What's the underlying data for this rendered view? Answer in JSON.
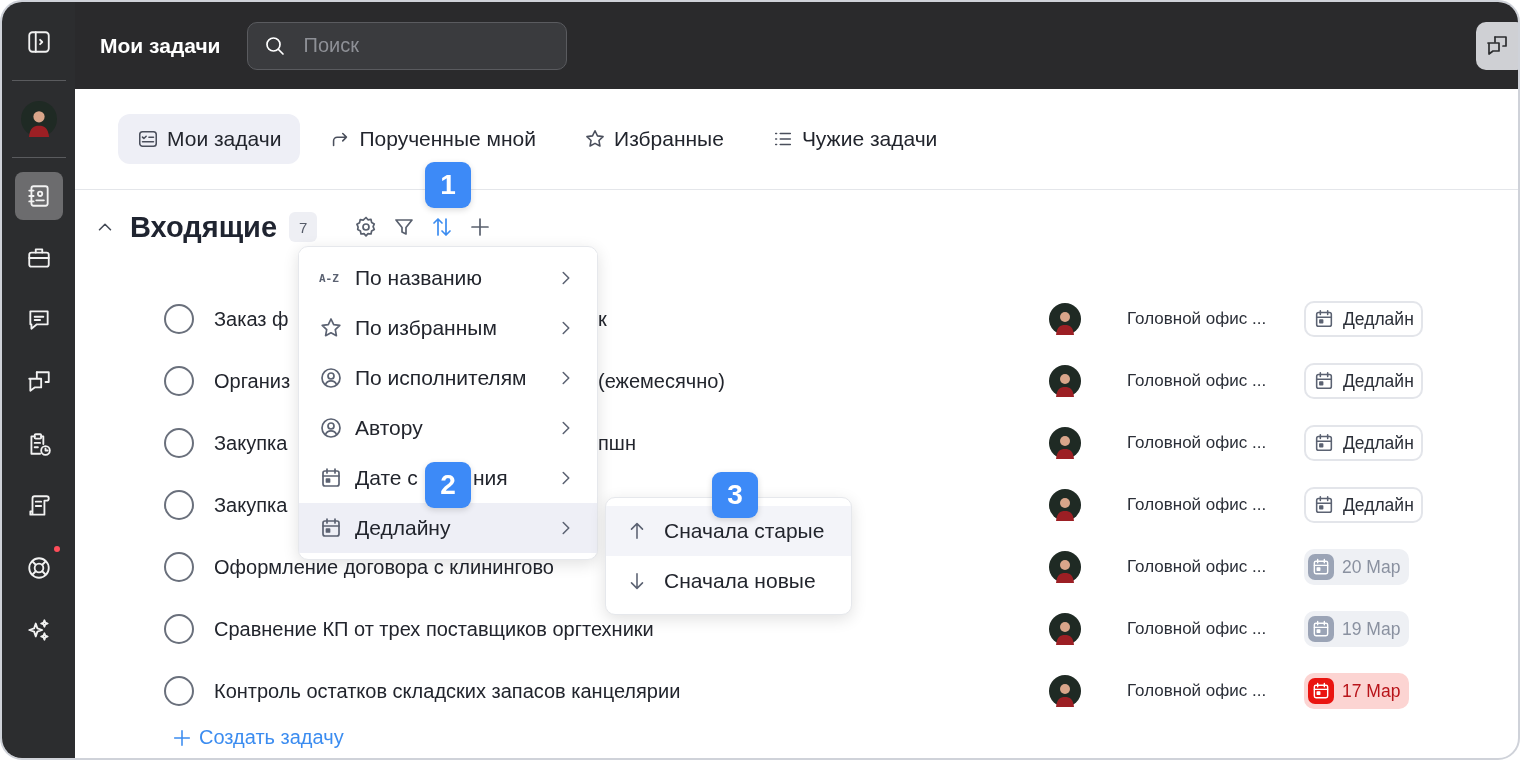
{
  "header": {
    "title": "Мои задачи",
    "search": {
      "placeholder": "Поиск"
    }
  },
  "sidebar": {
    "items": [
      {
        "selected": false,
        "notification": false
      },
      {
        "selected": true,
        "notification": false
      },
      {
        "selected": false,
        "notification": false
      },
      {
        "selected": false,
        "notification": false
      },
      {
        "selected": false,
        "notification": false
      },
      {
        "selected": false,
        "notification": false
      },
      {
        "selected": false,
        "notification": false
      },
      {
        "selected": false,
        "notification": true
      },
      {
        "selected": false,
        "notification": false
      }
    ]
  },
  "tabs": [
    {
      "label": "Мои задачи",
      "selected": true
    },
    {
      "label": "Порученные мной",
      "selected": false
    },
    {
      "label": "Избранные",
      "selected": false
    },
    {
      "label": "Чужие задачи",
      "selected": false
    }
  ],
  "section": {
    "title": "Входящие",
    "count": "7",
    "expanded": true,
    "tools": [
      {
        "active": false
      },
      {
        "active": false
      },
      {
        "active": true
      },
      {
        "active": false
      }
    ]
  },
  "tasks": [
    {
      "title_start": "Заказ ф",
      "title_end": "к",
      "done": false,
      "location": "Головной офис ...",
      "deadline": {
        "kind": "empty",
        "label": "Дедлайн"
      }
    },
    {
      "title_start": "Организ",
      "title_end": "(ежемесячно)",
      "done": false,
      "location": "Головной офис ...",
      "deadline": {
        "kind": "empty",
        "label": "Дедлайн"
      }
    },
    {
      "title_start": "Закупка",
      "title_end": "пшн",
      "done": false,
      "location": "Головной офис ...",
      "deadline": {
        "kind": "empty",
        "label": "Дедлайн"
      }
    },
    {
      "title_start": "Закупка",
      "done": false,
      "location": "Головной офис ...",
      "deadline": {
        "kind": "empty",
        "label": "Дедлайн"
      }
    },
    {
      "title_start": "Оформление договора с клинингово",
      "done": false,
      "location": "Головной офис ...",
      "deadline": {
        "kind": "future",
        "label": "20 Мар"
      }
    },
    {
      "title_start": "Сравнение КП от трех поставщиков оргтехники",
      "done": false,
      "location": "Головной офис ...",
      "deadline": {
        "kind": "future",
        "label": "19 Мар"
      }
    },
    {
      "title_start": "Контроль остатков складских запасов канцелярии",
      "done": false,
      "location": "Головной офис ...",
      "deadline": {
        "kind": "overdue",
        "label": "17 Мар"
      }
    }
  ],
  "create_task": {
    "label": "Создать задачу"
  },
  "sort_menu": {
    "items": [
      {
        "icon_text": "A-Z",
        "label": "По названию",
        "selected": false
      },
      {
        "label": "По избранным",
        "selected": false
      },
      {
        "label": "По исполнителям",
        "selected": false
      },
      {
        "label": "Автору",
        "selected": false
      },
      {
        "label": "Дате с",
        "label_end": "ния",
        "selected": false
      },
      {
        "label": "Дедлайну",
        "selected": true
      }
    ]
  },
  "sort_submenu": {
    "items": [
      {
        "label": "Сначала старые",
        "selected": true
      },
      {
        "label": "Сначала новые",
        "selected": false
      }
    ]
  },
  "callouts": [
    {
      "label": "1"
    },
    {
      "label": "2"
    },
    {
      "label": "3"
    }
  ]
}
